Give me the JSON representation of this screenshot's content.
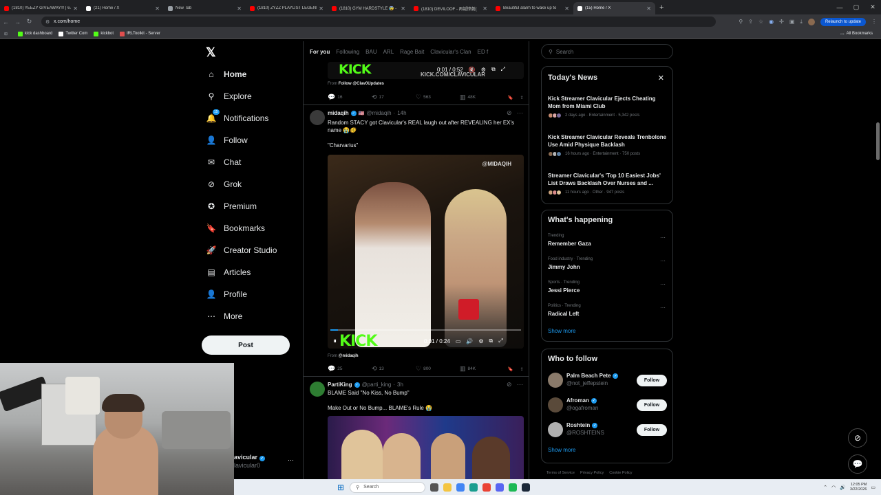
{
  "browser": {
    "tabs": [
      {
        "title": "(1810) YEEZY GIVEAWAY!!! | 67",
        "favicon_color": "#ff0000"
      },
      {
        "title": "(21) Home / X",
        "favicon_color": "#ffffff"
      },
      {
        "title": "New Tab",
        "favicon_color": "#9aa0a6"
      },
      {
        "title": "(1810) ZYZZ PLAYLIST LEGEND",
        "favicon_color": "#ff0000"
      },
      {
        "title": "(1810) GYM HARDSTYLE 😰 -",
        "favicon_color": "#ff0000"
      },
      {
        "title": "(1810) DEVILOOF - 再誕惨劇(",
        "favicon_color": "#ff0000"
      },
      {
        "title": "Beautiful alarm to wake up to",
        "favicon_color": "#ff0000"
      },
      {
        "title": "(15) Home / X",
        "favicon_color": "#ffffff",
        "active": true
      }
    ],
    "url": "x.com/home",
    "relaunch_label": "Relaunch to update",
    "bookmarks": [
      {
        "label": "kick dashboard",
        "color": "#53fc18"
      },
      {
        "label": "Twitter Com",
        "color": "#ffffff"
      },
      {
        "label": "kickbot",
        "color": "#53fc18"
      },
      {
        "label": "IRLToolkit - Server",
        "color": "#e04e4e"
      }
    ],
    "all_bookmarks_label": "All Bookmarks"
  },
  "nav": {
    "items": [
      {
        "label": "Home",
        "icon": "home-icon",
        "glyph": "⌂",
        "bold": true
      },
      {
        "label": "Explore",
        "icon": "search-icon",
        "glyph": "⚲"
      },
      {
        "label": "Notifications",
        "icon": "bell-icon",
        "glyph": "🔔",
        "badge": "15"
      },
      {
        "label": "Follow",
        "icon": "add-person-icon",
        "glyph": "👤"
      },
      {
        "label": "Chat",
        "icon": "mail-icon",
        "glyph": "✉"
      },
      {
        "label": "Grok",
        "icon": "grok-icon",
        "glyph": "⊘"
      },
      {
        "label": "Premium",
        "icon": "premium-icon",
        "glyph": "✪"
      },
      {
        "label": "Bookmarks",
        "icon": "bookmark-icon",
        "glyph": "🔖"
      },
      {
        "label": "Creator Studio",
        "icon": "rocket-icon",
        "glyph": "🚀"
      },
      {
        "label": "Articles",
        "icon": "articles-icon",
        "glyph": "▤"
      },
      {
        "label": "Profile",
        "icon": "person-icon",
        "glyph": "👤"
      },
      {
        "label": "More",
        "icon": "more-icon",
        "glyph": "⋯"
      }
    ],
    "post_label": "Post",
    "account_name": "avicular",
    "account_handle": "lavicular0"
  },
  "timeline": {
    "tabs": [
      "For you",
      "Following",
      "BAU",
      "ARL",
      "Rage Bait",
      "Clavicular's Clan",
      "ED f"
    ],
    "tweet0": {
      "video_time": "0:01 / 0:52",
      "kick_watermark": "KICK.COM/CLAVICULAR",
      "from_prefix": "From",
      "from_user": "Follow @Clav0Updates",
      "stats": {
        "replies": "16",
        "reposts": "17",
        "likes": "563",
        "views": "48K"
      }
    },
    "tweet1": {
      "name": "midaqih",
      "handle": "@midaqih",
      "time": "14h",
      "text_line1": "Random STACY got Clavicular's REAL laugh out after REVEALING her EX's",
      "text_line2": "name 😭🫨",
      "text_line3": "\"Charvarius\"",
      "video_watermark": "@MIDAQIH",
      "video_time": "0:01 / 0:24",
      "kick_logo": "KICK",
      "from_prefix": "From",
      "from_user": "@midaqih",
      "stats": {
        "replies": "25",
        "reposts": "13",
        "likes": "800",
        "views": "84K"
      }
    },
    "tweet2": {
      "name": "PartiKing",
      "handle": "@parti_king",
      "time": "3h",
      "text_line1": "BLAME Said \"No Kiss, No Bump\"",
      "text_line2": "Make Out or No Bump... BLAME's Rule 😭"
    }
  },
  "sidebar": {
    "search_placeholder": "Search",
    "news": {
      "title": "Today's News",
      "items": [
        {
          "headline": "Kick Streamer Clavicular Ejects Cheating Mom from Miami Club",
          "meta": "2 days ago · Entertainment · 5,342 posts"
        },
        {
          "headline": "Kick Streamer Clavicular Reveals Trenbolone Use Amid Physique Backlash",
          "meta": "16 hours ago · Entertainment · 750 posts"
        },
        {
          "headline": "Streamer Clavicular's 'Top 10 Easiest Jobs' List Draws Backlash Over Nurses and ...",
          "meta": "11 hours ago · Other · 947 posts"
        }
      ]
    },
    "happening": {
      "title": "What's happening",
      "trends": [
        {
          "category": "Trending",
          "name": "Remember Gaza"
        },
        {
          "category": "Food industry · Trending",
          "name": "Jimmy John"
        },
        {
          "category": "Sports · Trending",
          "name": "Jessi Pierce"
        },
        {
          "category": "Politics · Trending",
          "name": "Radical Left"
        }
      ],
      "show_more": "Show more"
    },
    "who_to_follow": {
      "title": "Who to follow",
      "accounts": [
        {
          "name": "Palm Beach Pete",
          "handle": "@not_jeffepstein",
          "follow": "Follow"
        },
        {
          "name": "Afroman",
          "handle": "@ogafroman",
          "follow": "Follow"
        },
        {
          "name": "Roshtein",
          "handle": "@ROSHTEINS",
          "follow": "Follow"
        }
      ],
      "show_more": "Show more"
    },
    "footer": [
      "Terms of Service",
      "Privacy Policy",
      "Cookie Policy"
    ]
  },
  "taskbar": {
    "search_placeholder": "Search",
    "time": "12:05 PM",
    "date": "3/22/2026"
  }
}
